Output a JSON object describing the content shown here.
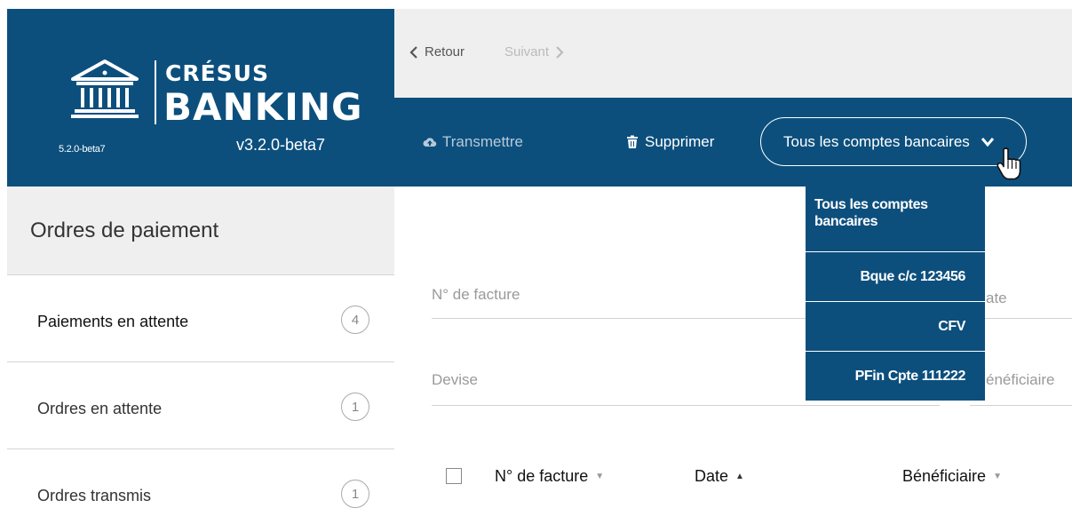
{
  "brand": {
    "name_top": "CRÉSUS",
    "name_bottom": "BANKING",
    "version_small": "5.2.0-beta7",
    "version": "v3.2.0-beta7"
  },
  "nav": {
    "back_label": "Retour",
    "next_label": "Suivant"
  },
  "toolbar": {
    "transmit_label": "Transmettre",
    "delete_label": "Supprimer",
    "account_select": "Tous les comptes bancaires"
  },
  "sidebar": {
    "title": "Ordres de paiement",
    "items": [
      {
        "label": "Paiements en attente",
        "count": "4",
        "active": true
      },
      {
        "label": "Ordres en attente",
        "count": "1",
        "active": false
      },
      {
        "label": "Ordres transmis",
        "count": "1",
        "active": false
      }
    ]
  },
  "filters": {
    "invoice_no": "N° de facture",
    "date_partial": "ate",
    "currency": "Devise",
    "beneficiary_partial": "énéficiaire"
  },
  "table": {
    "columns": [
      "N° de facture",
      "Date",
      "Bénéficiaire"
    ]
  },
  "dropdown": {
    "options": [
      "Tous les comptes bancaires",
      "Bque c/c 123456",
      "CFV",
      "PFin Cpte 111222"
    ]
  },
  "colors": {
    "brand_blue": "#0c4f7d",
    "panel_gray": "#efefef"
  }
}
